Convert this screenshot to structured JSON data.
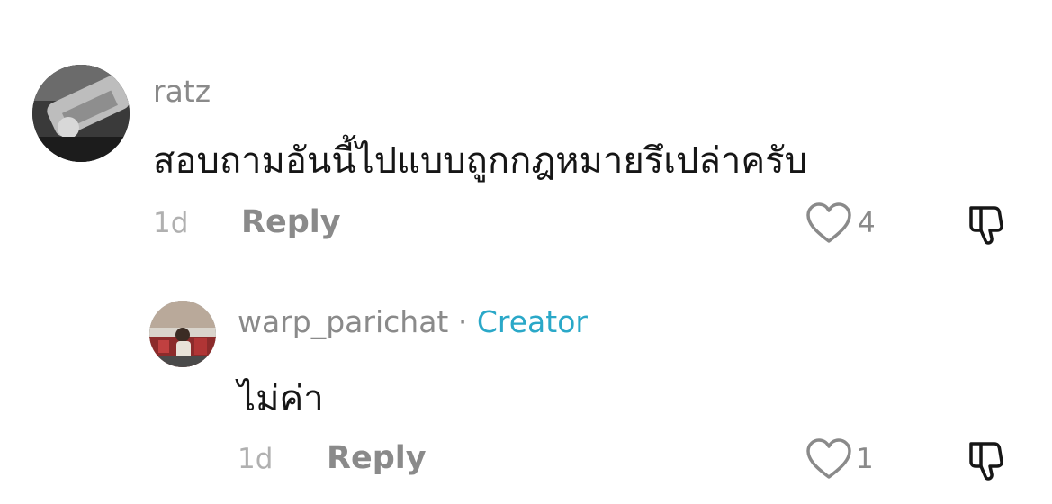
{
  "comments": [
    {
      "username": "ratz",
      "text": "สอบถามอันนี้ไปแบบถูกกฎหมายรึเปล่าครับ",
      "time": "1d",
      "reply_label": "Reply",
      "likes": "4",
      "avatar_icon": "wrench-avatar"
    }
  ],
  "reply": {
    "username": "warp_parichat",
    "separator": "·",
    "badge": "Creator",
    "text": "ไม่ค่า",
    "time": "1d",
    "reply_label": "Reply",
    "likes": "1",
    "avatar_icon": "person-photo-avatar"
  },
  "icons": {
    "like": "heart-outline-icon",
    "dislike": "thumbs-down-icon"
  },
  "colors": {
    "creator_badge": "#2aa8c8",
    "username": "#8a8a8a",
    "text": "#161616",
    "muted": "#b0b0b0"
  }
}
